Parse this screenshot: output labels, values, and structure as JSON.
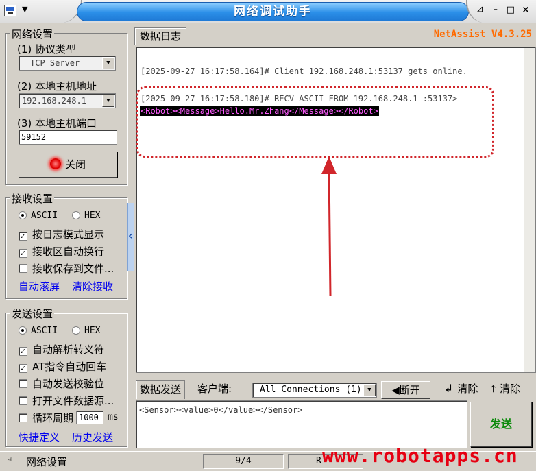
{
  "window": {
    "title": "网络调试助手",
    "version": "NetAssist V4.3.25"
  },
  "network": {
    "group_title": "网络设置",
    "protocol_label": "(1) 协议类型",
    "protocol_value": "TCP Server",
    "host_label": "(2) 本地主机地址",
    "host_value": "192.168.248.1",
    "port_label": "(3) 本地主机端口",
    "port_value": "59152",
    "close_label": "关闭"
  },
  "receive": {
    "group_title": "接收设置",
    "radio_ascii": "ASCII",
    "radio_hex": "HEX",
    "mode_selected": "ASCII",
    "opt_log": "按日志模式显示",
    "opt_wrap": "接收区自动换行",
    "opt_save": "接收保存到文件...",
    "opt_log_checked": true,
    "opt_wrap_checked": true,
    "opt_save_checked": false,
    "link_autoscroll": "自动滚屏",
    "link_clear": "清除接收"
  },
  "send_settings": {
    "group_title": "发送设置",
    "radio_ascii": "ASCII",
    "radio_hex": "HEX",
    "mode_selected": "ASCII",
    "opt_escape": "自动解析转义符",
    "opt_at": "AT指令自动回车",
    "opt_checksum": "自动发送校验位",
    "opt_file": "打开文件数据源...",
    "opt_loop": "循环周期",
    "loop_value": "1000",
    "loop_unit": "ms",
    "opt_escape_checked": true,
    "opt_at_checked": true,
    "opt_checksum_checked": false,
    "opt_file_checked": false,
    "opt_loop_checked": false,
    "link_shortcut": "快捷定义",
    "link_history": "历史发送"
  },
  "log": {
    "tab_label": "数据日志",
    "line1": "[2025-09-27 16:17:58.164]# Client 192.168.248.1:53137 gets online.",
    "line2": "[2025-09-27 16:17:58.180]# RECV ASCII FROM 192.168.248.1 :53137>",
    "line3": "<Robot><Message>Hello.Mr.Zhang</Message></Robot>"
  },
  "send": {
    "tab_label": "数据发送",
    "client_label": "客户端:",
    "connections_value": "All Connections (1)",
    "disconnect_label": "断开",
    "clear1_label": "清除",
    "clear2_label": "清除",
    "input_value": "<Sensor><value>0</value></Sensor>",
    "send_button": "发送"
  },
  "status": {
    "left_label": "网络设置",
    "counter": "9/4",
    "rx_partial": "R",
    "watermark": "www.robotapps.cn"
  }
}
